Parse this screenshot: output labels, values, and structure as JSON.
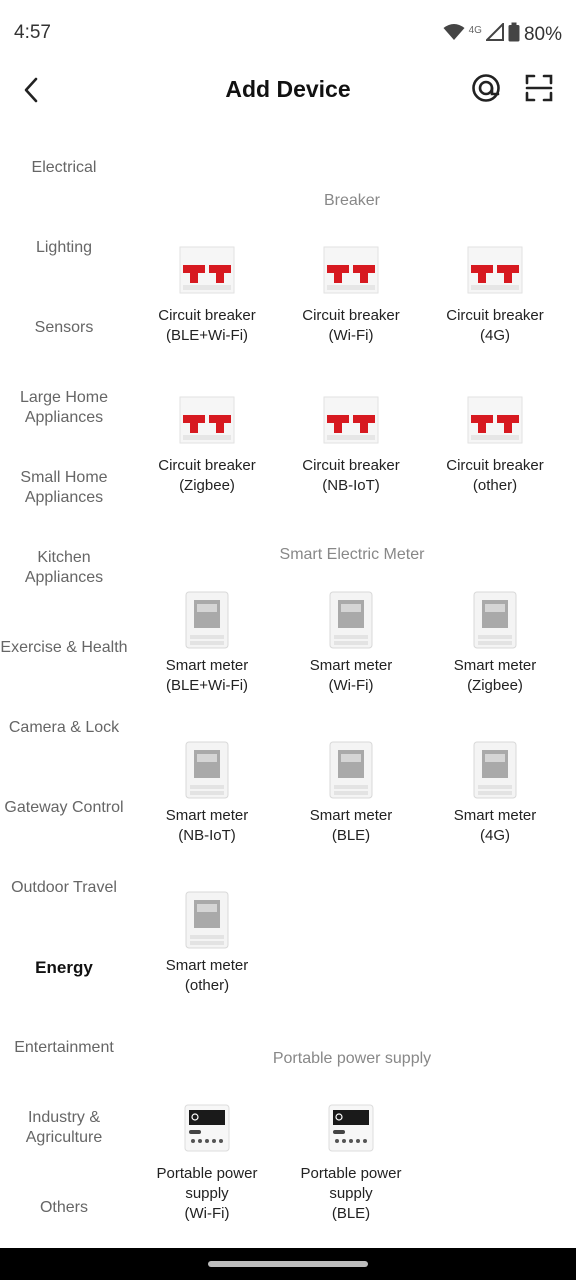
{
  "status_bar": {
    "time": "4:57",
    "network": "4G",
    "battery": "80%"
  },
  "header": {
    "title": "Add Device"
  },
  "sidebar": {
    "items": [
      {
        "label": "Electrical",
        "active": false
      },
      {
        "label": "Lighting",
        "active": false
      },
      {
        "label": "Sensors",
        "active": false
      },
      {
        "label": "Large Home Appliances",
        "active": false
      },
      {
        "label": "Small Home Appliances",
        "active": false
      },
      {
        "label": "Kitchen Appliances",
        "active": false
      },
      {
        "label": "Exercise & Health",
        "active": false
      },
      {
        "label": "Camera & Lock",
        "active": false
      },
      {
        "label": "Gateway Control",
        "active": false
      },
      {
        "label": "Outdoor Travel",
        "active": false
      },
      {
        "label": "Energy",
        "active": true
      },
      {
        "label": "Entertainment",
        "active": false
      },
      {
        "label": "Industry & Agriculture",
        "active": false
      },
      {
        "label": "Others",
        "active": false
      }
    ]
  },
  "sections": [
    {
      "title": "Breaker",
      "icon": "breaker-icon",
      "devices": [
        {
          "name": "Circuit breaker",
          "variant": "(BLE+Wi-Fi)"
        },
        {
          "name": "Circuit breaker",
          "variant": "(Wi-Fi)"
        },
        {
          "name": "Circuit breaker",
          "variant": "(4G)"
        },
        {
          "name": "Circuit breaker",
          "variant": "(Zigbee)"
        },
        {
          "name": "Circuit breaker",
          "variant": "(NB-IoT)"
        },
        {
          "name": "Circuit breaker",
          "variant": "(other)"
        }
      ]
    },
    {
      "title": "Smart Electric Meter",
      "icon": "smart-meter-icon",
      "devices": [
        {
          "name": "Smart meter",
          "variant": "(BLE+Wi-Fi)"
        },
        {
          "name": "Smart meter",
          "variant": "(Wi-Fi)"
        },
        {
          "name": "Smart meter",
          "variant": "(Zigbee)"
        },
        {
          "name": "Smart meter",
          "variant": "(NB-IoT)"
        },
        {
          "name": "Smart meter",
          "variant": "(BLE)"
        },
        {
          "name": "Smart meter",
          "variant": "(4G)"
        },
        {
          "name": "Smart meter",
          "variant": "(other)"
        }
      ]
    },
    {
      "title": "Portable power supply",
      "icon": "power-supply-icon",
      "devices": [
        {
          "name": "Portable power supply",
          "variant": "(Wi-Fi)"
        },
        {
          "name": "Portable power supply",
          "variant": "(BLE)"
        }
      ]
    }
  ],
  "colors": {
    "breaker_red": "#d71920",
    "accent_active": "#111111",
    "muted_text": "#666666"
  }
}
